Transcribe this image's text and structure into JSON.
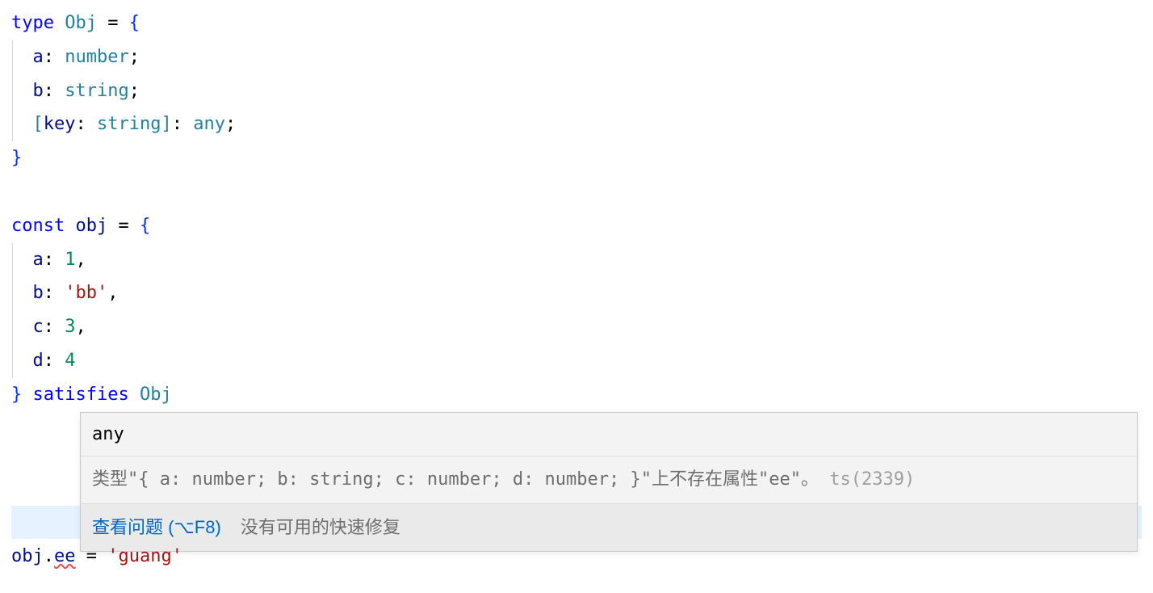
{
  "code": {
    "l1": {
      "type_kw": "type",
      "name": "Obj",
      "eq": " = ",
      "open": "{"
    },
    "l2": {
      "indent": "  ",
      "prop": "a",
      "colon": ": ",
      "typ": "number",
      "semi": ";"
    },
    "l3": {
      "indent": "  ",
      "prop": "b",
      "colon": ": ",
      "typ": "string",
      "semi": ";"
    },
    "l4": {
      "indent": "  ",
      "open": "[",
      "key_kw": "key",
      "colon1": ": ",
      "key_t": "string",
      "close_b": "]",
      "colon2": ": ",
      "val_t": "any",
      "semi": ";"
    },
    "l5": {
      "close": "}"
    },
    "l7": {
      "const_kw": "const",
      "name": " obj",
      "eq": " = ",
      "open": "{"
    },
    "l8": {
      "indent": "  ",
      "prop": "a",
      "colon": ": ",
      "val": "1",
      "comma": ","
    },
    "l9": {
      "indent": "  ",
      "prop": "b",
      "colon": ": ",
      "val": "'bb'",
      "comma": ","
    },
    "l10": {
      "indent": "  ",
      "prop": "c",
      "colon": ": ",
      "val": "3",
      "comma": ","
    },
    "l11": {
      "indent": "  ",
      "prop": "d",
      "colon": ": ",
      "val": "4"
    },
    "l12": {
      "close": "}",
      "sat_kw": " satisfies ",
      "typ": "Obj"
    },
    "l14": {
      "obj": "obj",
      "dot": ".",
      "prop": "ee",
      "eq": " = ",
      "val": "'guang'"
    }
  },
  "tooltip": {
    "type_info": "any",
    "error_msg": "类型\"{ a: number; b: string; c: number; d: number; }\"上不存在属性\"ee\"。",
    "ts_code": "ts(2339)",
    "view_problem": "查看问题 (⌥F8)",
    "no_quickfix": "没有可用的快速修复"
  }
}
